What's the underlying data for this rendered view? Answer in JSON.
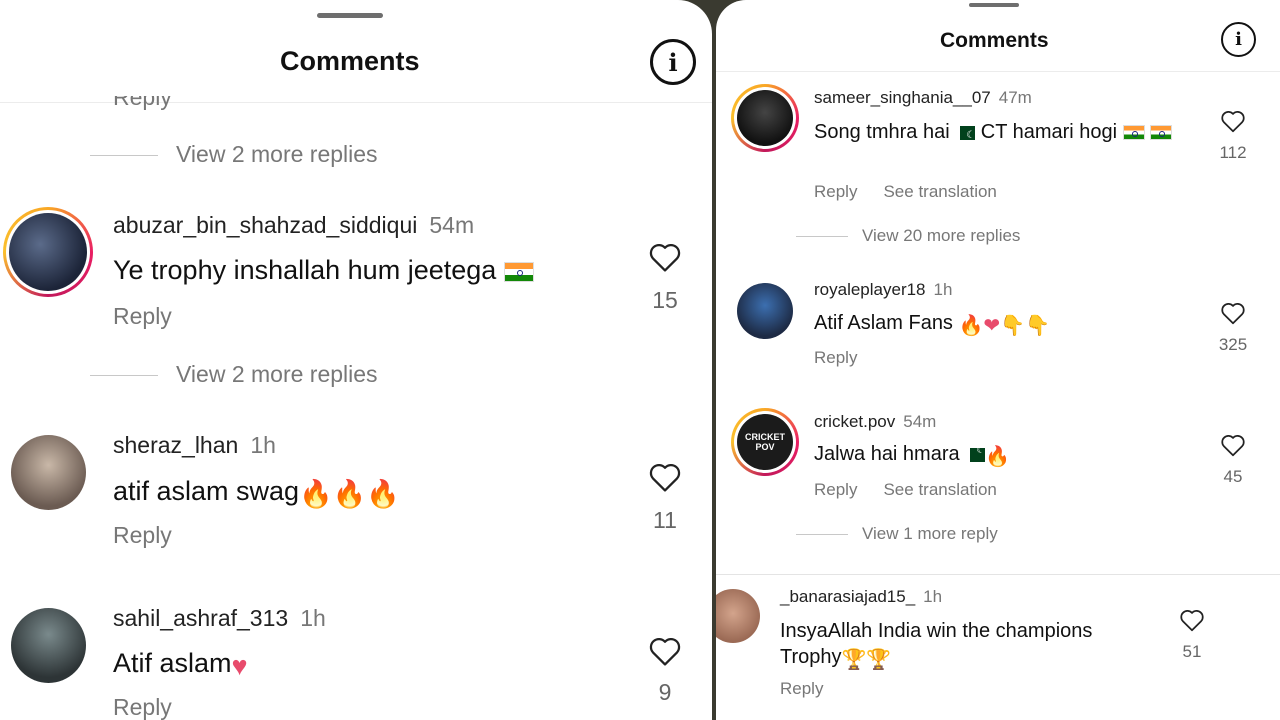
{
  "left": {
    "title": "Comments",
    "cut_reply": "Reply",
    "view_more_1": "View 2 more replies",
    "comments": [
      {
        "user": "abuzar_bin_shahzad_siddiqui",
        "time": "54m",
        "text": "Ye trophy inshallah hum jeetega",
        "reply": "Reply",
        "likes": "15"
      },
      {
        "user": "sheraz_lhan",
        "time": "1h",
        "text": "atif aslam swag",
        "reply": "Reply",
        "likes": "11"
      },
      {
        "user": "sahil_ashraf_313",
        "time": "1h",
        "text": "Atif aslam",
        "reply": "Reply",
        "likes": "9"
      }
    ],
    "view_more_2": "View 2 more replies"
  },
  "right": {
    "title": "Comments",
    "comments": [
      {
        "user": "sameer_singhania__07",
        "time": "47m",
        "text_a": "Song tmhra hai",
        "text_b": "CT hamari hogi",
        "reply": "Reply",
        "translate": "See translation",
        "likes": "112"
      },
      {
        "user": "royaleplayer18",
        "time": "1h",
        "text": "Atif Aslam Fans",
        "reply": "Reply",
        "likes": "325"
      },
      {
        "user": "cricket.pov",
        "time": "54m",
        "text": "Jalwa hai hmara",
        "reply": "Reply",
        "translate": "See translation",
        "likes": "45"
      },
      {
        "user": "_banarasiajad15_",
        "time": "1h",
        "text_a": "InsyaAllah India win the champions",
        "text_b": "Trophy",
        "reply": "Reply",
        "likes": "51"
      }
    ],
    "view_more_1": "View 20 more replies",
    "view_more_2": "View 1 more reply",
    "avatar_text": "CRICKET POV"
  },
  "icons": [
    "info-icon",
    "heart-outline-icon",
    "india-flag-emoji",
    "pakistan-flag-emoji",
    "fire-emoji",
    "red-heart-emoji",
    "pointing-down-emoji",
    "trophy-emoji"
  ],
  "colors": {
    "story_ring": "#e91e63",
    "muted_text": "#777777",
    "heart": "#e84b6c"
  }
}
